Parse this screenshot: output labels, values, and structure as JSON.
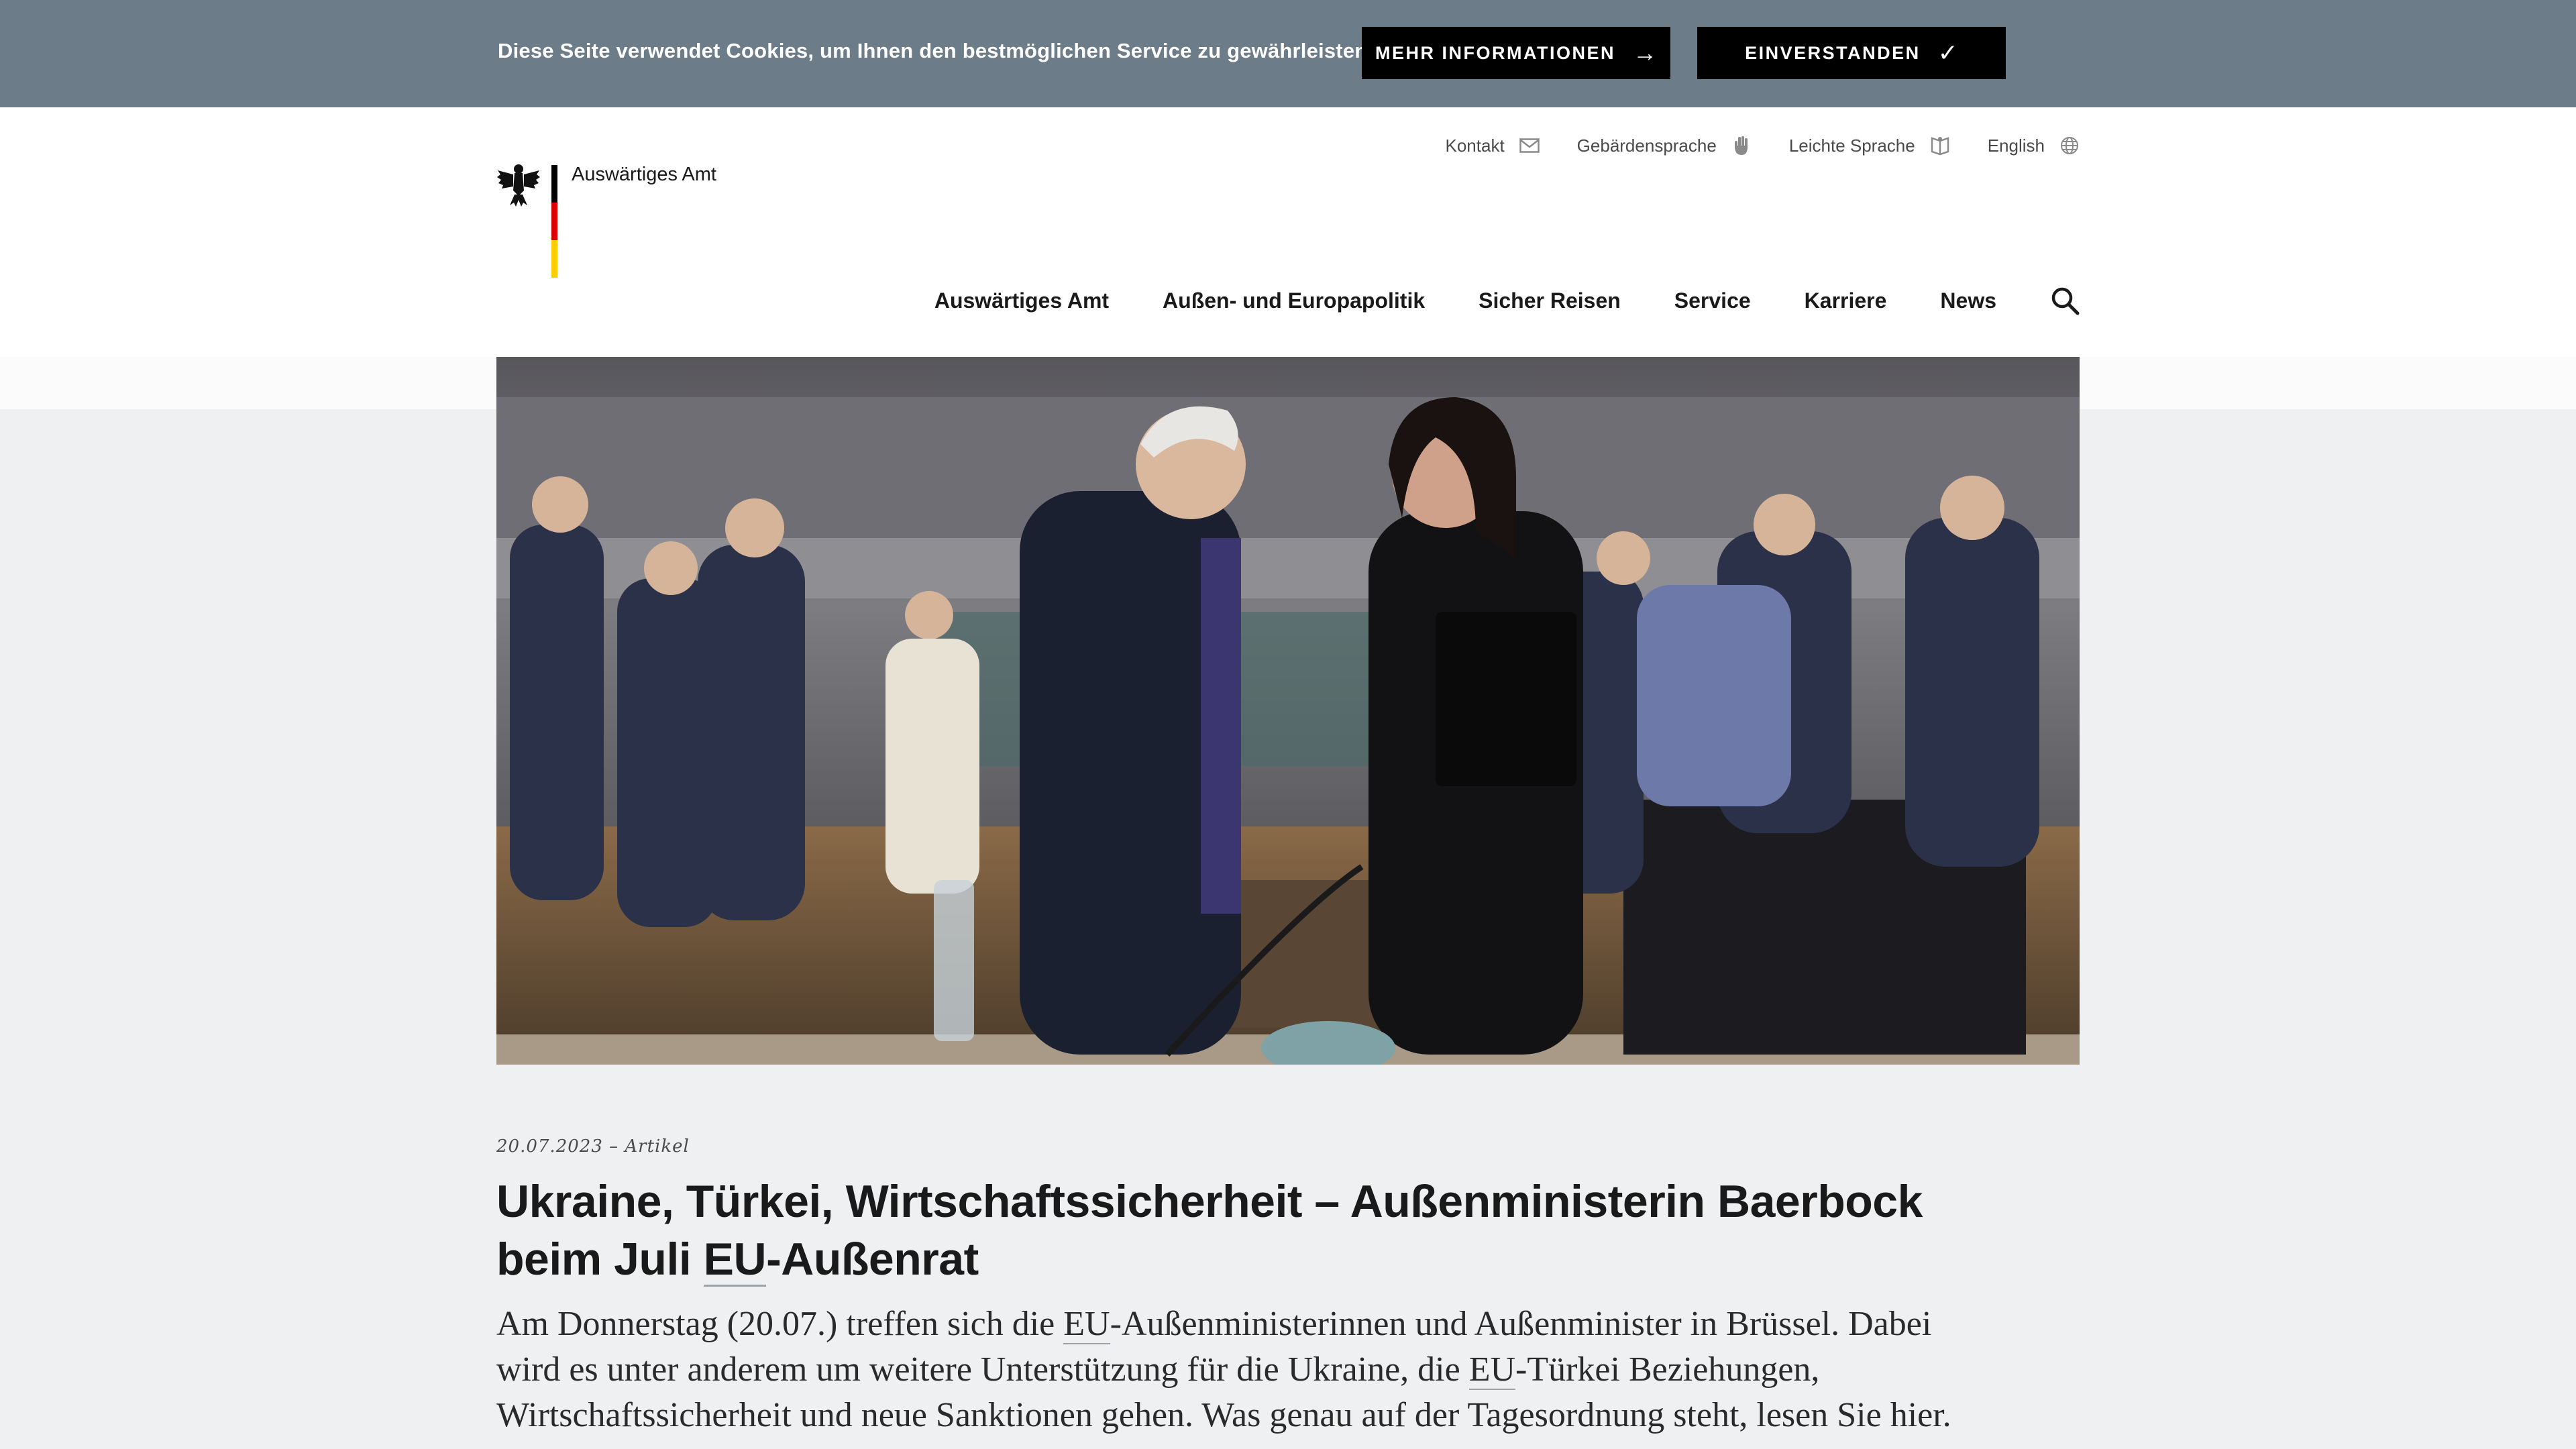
{
  "cookie_banner": {
    "text": "Diese Seite verwendet Cookies, um Ihnen den bestmöglichen Service zu gewährleisten.",
    "more_info_label": "MEHR INFORMATIONEN",
    "agree_label": "EINVERSTANDEN",
    "background": "#6c7d89"
  },
  "brand": {
    "name": "Auswärtiges Amt",
    "flag_colors": [
      "#000000",
      "#dd0000",
      "#ffce00"
    ]
  },
  "meta_nav": [
    {
      "label": "Kontakt",
      "icon": "envelope-icon"
    },
    {
      "label": "Gebärdensprache",
      "icon": "hand-icon"
    },
    {
      "label": "Leichte Sprache",
      "icon": "book-icon"
    },
    {
      "label": "English",
      "icon": "globe-icon"
    }
  ],
  "main_nav": [
    {
      "label": "Auswärtiges Amt"
    },
    {
      "label": "Außen- und Europapolitik"
    },
    {
      "label": "Sicher Reisen"
    },
    {
      "label": "Service"
    },
    {
      "label": "Karriere"
    },
    {
      "label": "News"
    }
  ],
  "article": {
    "date": "20.07.2023",
    "separator": "–",
    "type": "Artikel",
    "title_part1": "Ukraine, Türkei, Wirtschaftssicherheit – Außenministerin Baerbock beim Juli ",
    "title_abbr": "EU",
    "title_part2": "-Außenrat",
    "teaser_1": "Am Donnerstag (20.07.) treffen sich die ",
    "teaser_abbr1": "EU",
    "teaser_2": "-Außenministerinnen und Außenminister in Brüssel. Dabei wird es unter anderem um weitere Unterstützung für die Ukraine, die ",
    "teaser_abbr2": "EU",
    "teaser_3": "-Türkei Beziehungen, Wirtschaftssicherheit und neue Sanktionen gehen. Was genau auf der Tagesordnung steht, lesen Sie hier."
  }
}
